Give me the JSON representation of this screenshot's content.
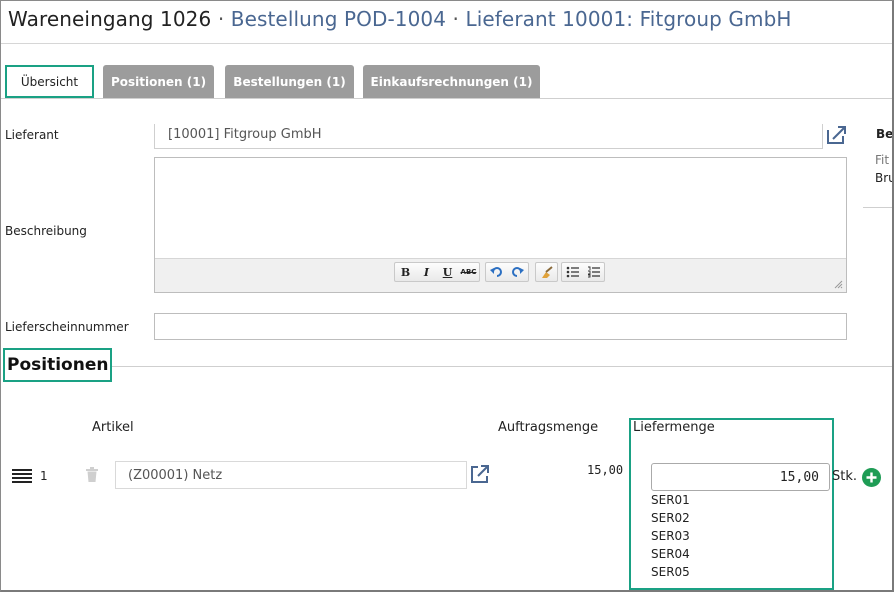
{
  "header": {
    "receipt": "Wareneingang 1026",
    "separator": "·",
    "order_link": "Bestellung POD-1004",
    "supplier_link": "Lieferant 10001: Fitgroup GmbH"
  },
  "tabs": [
    {
      "label": "Übersicht",
      "active": true
    },
    {
      "label": "Positionen (1)",
      "active": false
    },
    {
      "label": "Bestellungen (1)",
      "active": false
    },
    {
      "label": "Einkaufsrechnungen (1)",
      "active": false
    }
  ],
  "form": {
    "supplier_label": "Lieferant",
    "supplier_value": "[10001] Fitgroup GmbH",
    "description_label": "Beschreibung",
    "description_value": "",
    "delivery_note_label": "Lieferscheinnummer",
    "delivery_note_value": ""
  },
  "right_panel": {
    "title": "Be",
    "line1": "Fit",
    "line2": "Bru"
  },
  "editor_toolbar": {
    "bold": "B",
    "italic": "I",
    "underline": "U",
    "strike": "ABC"
  },
  "positions": {
    "title": "Positionen",
    "col_article": "Artikel",
    "col_order_qty": "Auftragsmenge",
    "col_delivery_qty": "Liefermenge",
    "rows": [
      {
        "number": "1",
        "article": "(Z00001) Netz",
        "order_qty": "15,00",
        "delivery_qty": "15,00",
        "unit": "Stk.",
        "serials": [
          "SER01",
          "SER02",
          "SER03",
          "SER04",
          "SER05"
        ]
      }
    ]
  },
  "colors": {
    "accent": "#1aa184",
    "link": "#4a6791",
    "tab_inactive": "#9c9c9c",
    "add_button": "#1e9c55"
  }
}
